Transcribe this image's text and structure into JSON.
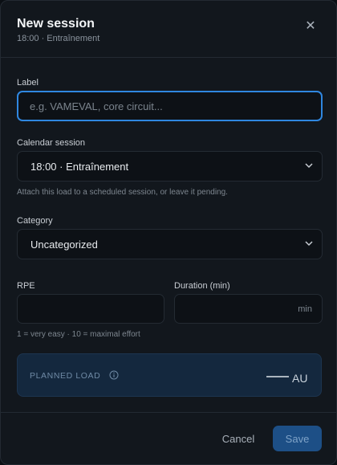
{
  "dialog": {
    "title": "New session",
    "subtitle": "18:00 · Entraînement",
    "close_icon": "close-icon"
  },
  "form": {
    "label": {
      "label": "Label",
      "value": "",
      "placeholder": "e.g. VAMEVAL, core circuit..."
    },
    "calendar_session": {
      "label": "Calendar session",
      "selected": "18:00 · Entraînement",
      "hint": "Attach this load to a scheduled session, or leave it pending."
    },
    "category": {
      "label": "Category",
      "selected": "Uncategorized"
    },
    "rpe": {
      "label": "RPE",
      "value": "",
      "hint": "1 = very easy · 10 = maximal effort"
    },
    "duration": {
      "label": "Duration (min)",
      "value": "",
      "suffix": "min"
    }
  },
  "planned_load": {
    "label": "PLANNED LOAD",
    "icon": "info-icon",
    "value": "",
    "unit": "AU"
  },
  "footer": {
    "cancel_label": "Cancel",
    "save_label": "Save"
  },
  "colors": {
    "accent": "#2f87e0",
    "save_button_bg": "#1d4f86",
    "planned_bg": "#14283e",
    "modal_bg": "#12171d"
  }
}
